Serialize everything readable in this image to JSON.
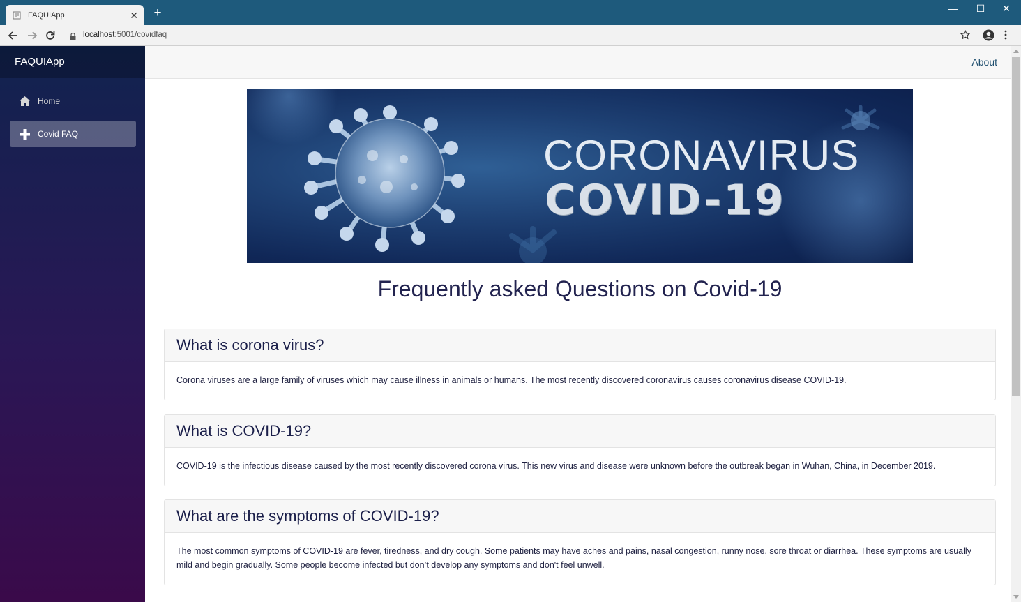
{
  "browser": {
    "tab_title": "FAQUIApp",
    "tab_close": "✕",
    "new_tab": "+",
    "url_host": "localhost",
    "url_rest": ":5001/covidfaq",
    "window_controls": [
      "—",
      "☐",
      "✕"
    ]
  },
  "app": {
    "brand": "FAQUIApp",
    "nav": [
      {
        "label": "Home",
        "icon": "home-icon",
        "active": false
      },
      {
        "label": "Covid FAQ",
        "icon": "plus-icon",
        "active": true
      }
    ],
    "top_link": "About"
  },
  "banner": {
    "line1": "CORONAVIRUS",
    "line2": "COVID-19"
  },
  "page": {
    "title": "Frequently asked Questions on Covid-19"
  },
  "faqs": [
    {
      "question": "What is corona virus?",
      "answer": "Corona viruses are a large family of viruses which may cause illness in animals or humans. The most recently discovered coronavirus causes coronavirus disease COVID-19."
    },
    {
      "question": "What is COVID-19?",
      "answer": "COVID-19 is the infectious disease caused by the most recently discovered corona virus. This new virus and disease were unknown before the outbreak began in Wuhan, China, in December 2019."
    },
    {
      "question": "What are the symptoms of COVID-19?",
      "answer": "The most common symptoms of COVID-19 are fever, tiredness, and dry cough. Some patients may have aches and pains, nasal congestion, runny nose, sore throat or diarrhea. These symptoms are usually mild and begin gradually. Some people become infected but don’t develop any symptoms and don't feel unwell."
    }
  ],
  "colors": {
    "browser_frame": "#1e5a7c",
    "sidebar_top": "#11234f",
    "sidebar_bottom": "#3a0a4a",
    "heading_text": "#22234f"
  }
}
